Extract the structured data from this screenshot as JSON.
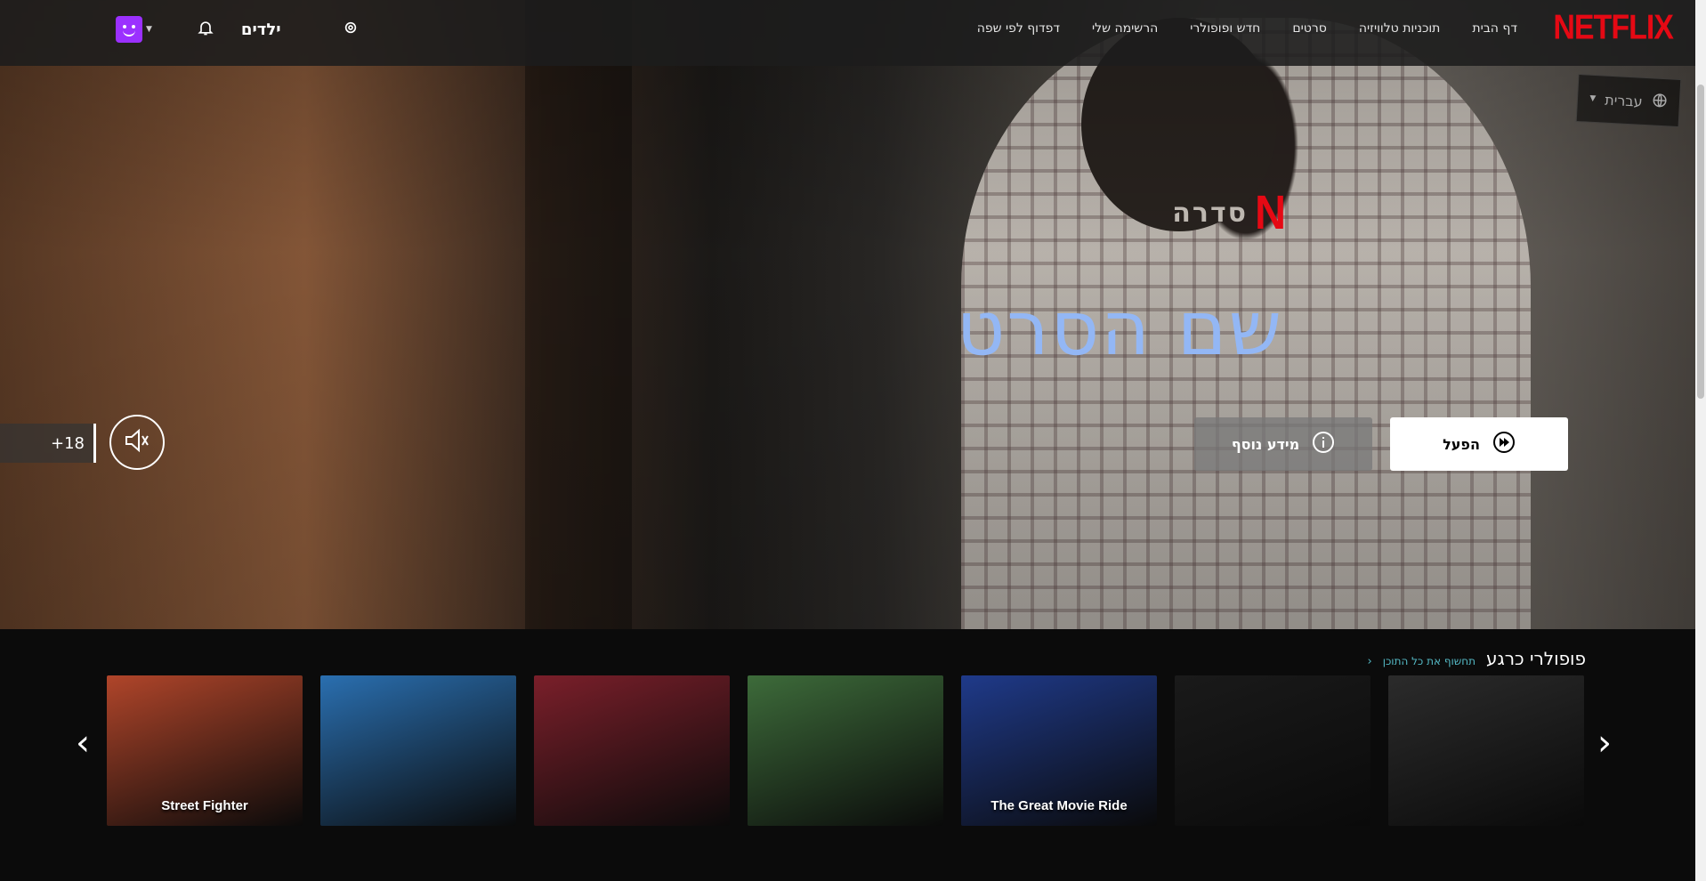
{
  "header": {
    "logo": "NETFLIX",
    "nav": [
      "דף הבית",
      "תוכניות טלוויזיה",
      "סרטים",
      "חדש ופופולרי",
      "הרשימה שלי",
      "דפדוף לפי שפה"
    ],
    "kids_label": "ילדים"
  },
  "language": {
    "selected": "עברית"
  },
  "hero": {
    "series_label": "סדרה",
    "title": "שם הסרט",
    "play_label": "הפעל",
    "more_info_label": "מידע נוסף",
    "maturity_rating": "+18"
  },
  "row": {
    "title": "פופולרי כרגע",
    "explore_label": "תחשוף את כל התוכן",
    "posters": [
      {
        "name": "fast-x-poster",
        "label": "",
        "bg": "#2b2b2b"
      },
      {
        "name": "abigail-poster",
        "label": "",
        "bg": "#1a1a1a"
      },
      {
        "name": "great-movie-ride-poster",
        "label": "The Great Movie Ride",
        "bg": "#1f3a8a"
      },
      {
        "name": "kim-possible-poster",
        "label": "",
        "bg": "#3d6b3a"
      },
      {
        "name": "x-men-poster",
        "label": "",
        "bg": "#7a1f2a"
      },
      {
        "name": "lego-movie-poster",
        "label": "",
        "bg": "#2a6fb0"
      },
      {
        "name": "street-fighter-poster",
        "label": "Street Fighter",
        "bg": "#b0452a"
      }
    ]
  },
  "colors": {
    "brand": "#e50914",
    "title": "#93b7f5",
    "accent": "#54b9c5"
  }
}
